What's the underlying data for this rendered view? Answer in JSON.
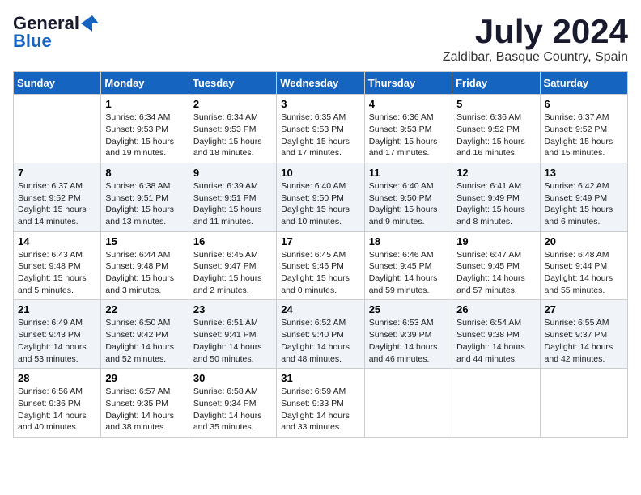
{
  "logo": {
    "line1": "General",
    "line2": "Blue"
  },
  "title": "July 2024",
  "location": "Zaldibar, Basque Country, Spain",
  "days_of_week": [
    "Sunday",
    "Monday",
    "Tuesday",
    "Wednesday",
    "Thursday",
    "Friday",
    "Saturday"
  ],
  "weeks": [
    [
      {
        "day": "",
        "content": ""
      },
      {
        "day": "1",
        "content": "Sunrise: 6:34 AM\nSunset: 9:53 PM\nDaylight: 15 hours and 19 minutes."
      },
      {
        "day": "2",
        "content": "Sunrise: 6:34 AM\nSunset: 9:53 PM\nDaylight: 15 hours and 18 minutes."
      },
      {
        "day": "3",
        "content": "Sunrise: 6:35 AM\nSunset: 9:53 PM\nDaylight: 15 hours and 17 minutes."
      },
      {
        "day": "4",
        "content": "Sunrise: 6:36 AM\nSunset: 9:53 PM\nDaylight: 15 hours and 17 minutes."
      },
      {
        "day": "5",
        "content": "Sunrise: 6:36 AM\nSunset: 9:52 PM\nDaylight: 15 hours and 16 minutes."
      },
      {
        "day": "6",
        "content": "Sunrise: 6:37 AM\nSunset: 9:52 PM\nDaylight: 15 hours and 15 minutes."
      }
    ],
    [
      {
        "day": "7",
        "content": "Sunrise: 6:37 AM\nSunset: 9:52 PM\nDaylight: 15 hours and 14 minutes."
      },
      {
        "day": "8",
        "content": "Sunrise: 6:38 AM\nSunset: 9:51 PM\nDaylight: 15 hours and 13 minutes."
      },
      {
        "day": "9",
        "content": "Sunrise: 6:39 AM\nSunset: 9:51 PM\nDaylight: 15 hours and 11 minutes."
      },
      {
        "day": "10",
        "content": "Sunrise: 6:40 AM\nSunset: 9:50 PM\nDaylight: 15 hours and 10 minutes."
      },
      {
        "day": "11",
        "content": "Sunrise: 6:40 AM\nSunset: 9:50 PM\nDaylight: 15 hours and 9 minutes."
      },
      {
        "day": "12",
        "content": "Sunrise: 6:41 AM\nSunset: 9:49 PM\nDaylight: 15 hours and 8 minutes."
      },
      {
        "day": "13",
        "content": "Sunrise: 6:42 AM\nSunset: 9:49 PM\nDaylight: 15 hours and 6 minutes."
      }
    ],
    [
      {
        "day": "14",
        "content": "Sunrise: 6:43 AM\nSunset: 9:48 PM\nDaylight: 15 hours and 5 minutes."
      },
      {
        "day": "15",
        "content": "Sunrise: 6:44 AM\nSunset: 9:48 PM\nDaylight: 15 hours and 3 minutes."
      },
      {
        "day": "16",
        "content": "Sunrise: 6:45 AM\nSunset: 9:47 PM\nDaylight: 15 hours and 2 minutes."
      },
      {
        "day": "17",
        "content": "Sunrise: 6:45 AM\nSunset: 9:46 PM\nDaylight: 15 hours and 0 minutes."
      },
      {
        "day": "18",
        "content": "Sunrise: 6:46 AM\nSunset: 9:45 PM\nDaylight: 14 hours and 59 minutes."
      },
      {
        "day": "19",
        "content": "Sunrise: 6:47 AM\nSunset: 9:45 PM\nDaylight: 14 hours and 57 minutes."
      },
      {
        "day": "20",
        "content": "Sunrise: 6:48 AM\nSunset: 9:44 PM\nDaylight: 14 hours and 55 minutes."
      }
    ],
    [
      {
        "day": "21",
        "content": "Sunrise: 6:49 AM\nSunset: 9:43 PM\nDaylight: 14 hours and 53 minutes."
      },
      {
        "day": "22",
        "content": "Sunrise: 6:50 AM\nSunset: 9:42 PM\nDaylight: 14 hours and 52 minutes."
      },
      {
        "day": "23",
        "content": "Sunrise: 6:51 AM\nSunset: 9:41 PM\nDaylight: 14 hours and 50 minutes."
      },
      {
        "day": "24",
        "content": "Sunrise: 6:52 AM\nSunset: 9:40 PM\nDaylight: 14 hours and 48 minutes."
      },
      {
        "day": "25",
        "content": "Sunrise: 6:53 AM\nSunset: 9:39 PM\nDaylight: 14 hours and 46 minutes."
      },
      {
        "day": "26",
        "content": "Sunrise: 6:54 AM\nSunset: 9:38 PM\nDaylight: 14 hours and 44 minutes."
      },
      {
        "day": "27",
        "content": "Sunrise: 6:55 AM\nSunset: 9:37 PM\nDaylight: 14 hours and 42 minutes."
      }
    ],
    [
      {
        "day": "28",
        "content": "Sunrise: 6:56 AM\nSunset: 9:36 PM\nDaylight: 14 hours and 40 minutes."
      },
      {
        "day": "29",
        "content": "Sunrise: 6:57 AM\nSunset: 9:35 PM\nDaylight: 14 hours and 38 minutes."
      },
      {
        "day": "30",
        "content": "Sunrise: 6:58 AM\nSunset: 9:34 PM\nDaylight: 14 hours and 35 minutes."
      },
      {
        "day": "31",
        "content": "Sunrise: 6:59 AM\nSunset: 9:33 PM\nDaylight: 14 hours and 33 minutes."
      },
      {
        "day": "",
        "content": ""
      },
      {
        "day": "",
        "content": ""
      },
      {
        "day": "",
        "content": ""
      }
    ]
  ]
}
